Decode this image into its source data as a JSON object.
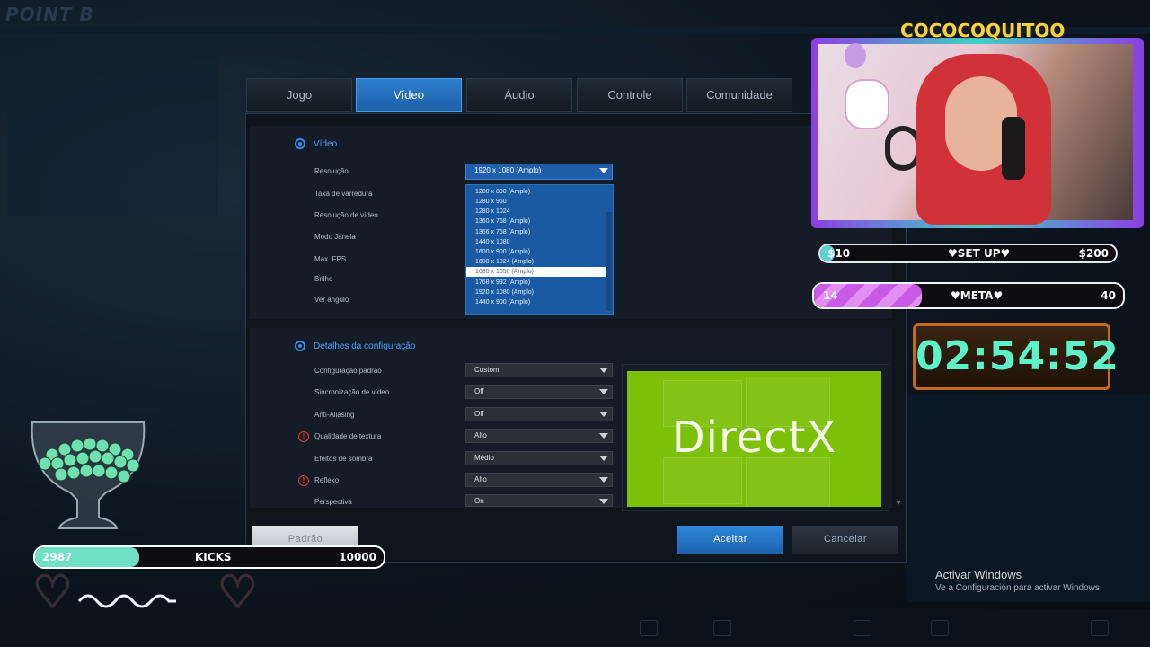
{
  "tabs": [
    {
      "label": "Jogo"
    },
    {
      "label": "Vídeo"
    },
    {
      "label": "Áudio"
    },
    {
      "label": "Controle"
    },
    {
      "label": "Comunidade"
    }
  ],
  "video_section": {
    "title": "Vídeo",
    "labels": [
      "Resolução",
      "Taxa de varredura",
      "Resolução de vídeo",
      "Modo Janela",
      "Max. FPS",
      "Brilho",
      "Ver ângulo"
    ],
    "resolution_value": "1920 x 1080 (Amplo)",
    "resolution_options": [
      "1280 x 800 (Amplo)",
      "1280 x 960",
      "1280 x 1024",
      "1360 x 768 (Amplo)",
      "1366 x 768 (Amplo)",
      "1440 x 1080",
      "1600 x 900 (Amplo)",
      "1600 x 1024 (Amplo)",
      "1680 x 1050 (Amplo)",
      "1768 x 992 (Amplo)",
      "1920 x 1080 (Amplo)",
      "1440 x 900 (Amplo)"
    ],
    "highlighted_option": "1680 x 1050 (Amplo)"
  },
  "config_section": {
    "title": "Detalhes da configuração",
    "rows": [
      {
        "label": "Configuração padrão",
        "value": "Custom",
        "warning": false
      },
      {
        "label": "Sincronização de vídeo",
        "value": "Off",
        "warning": false
      },
      {
        "label": "Anti-Aliasing",
        "value": "Off",
        "warning": false
      },
      {
        "label": "Qualidade de textura",
        "value": "Alto",
        "warning": true
      },
      {
        "label": "Efeitos de sombra",
        "value": "Médio",
        "warning": false
      },
      {
        "label": "Reflexo",
        "value": "Alto",
        "warning": true
      },
      {
        "label": "Perspectiva",
        "value": "On",
        "warning": false
      }
    ],
    "preview_text": "DirectX"
  },
  "buttons": {
    "default": "Padrão",
    "accept": "Aceitar",
    "cancel": "Cancelar"
  },
  "overlay": {
    "streamer_name": "COCOCOQUITOO",
    "setup_goal": {
      "current": "$10",
      "label": "♥SET UP♥",
      "target": "$200",
      "progress": 0.05
    },
    "meta_goal": {
      "current": "14",
      "label": "♥META♥",
      "target": "40",
      "progress": 0.35
    },
    "timer": "02:54:52",
    "kicks": {
      "current": "2987",
      "label": "KICKS",
      "target": "10000",
      "progress": 0.3
    },
    "accent_pink": "#c85be6",
    "accent_teal": "#5ef2c8"
  },
  "windows_watermark": {
    "line1": "Activar Windows",
    "line2": "Ve a Configuración para activar Windows."
  }
}
